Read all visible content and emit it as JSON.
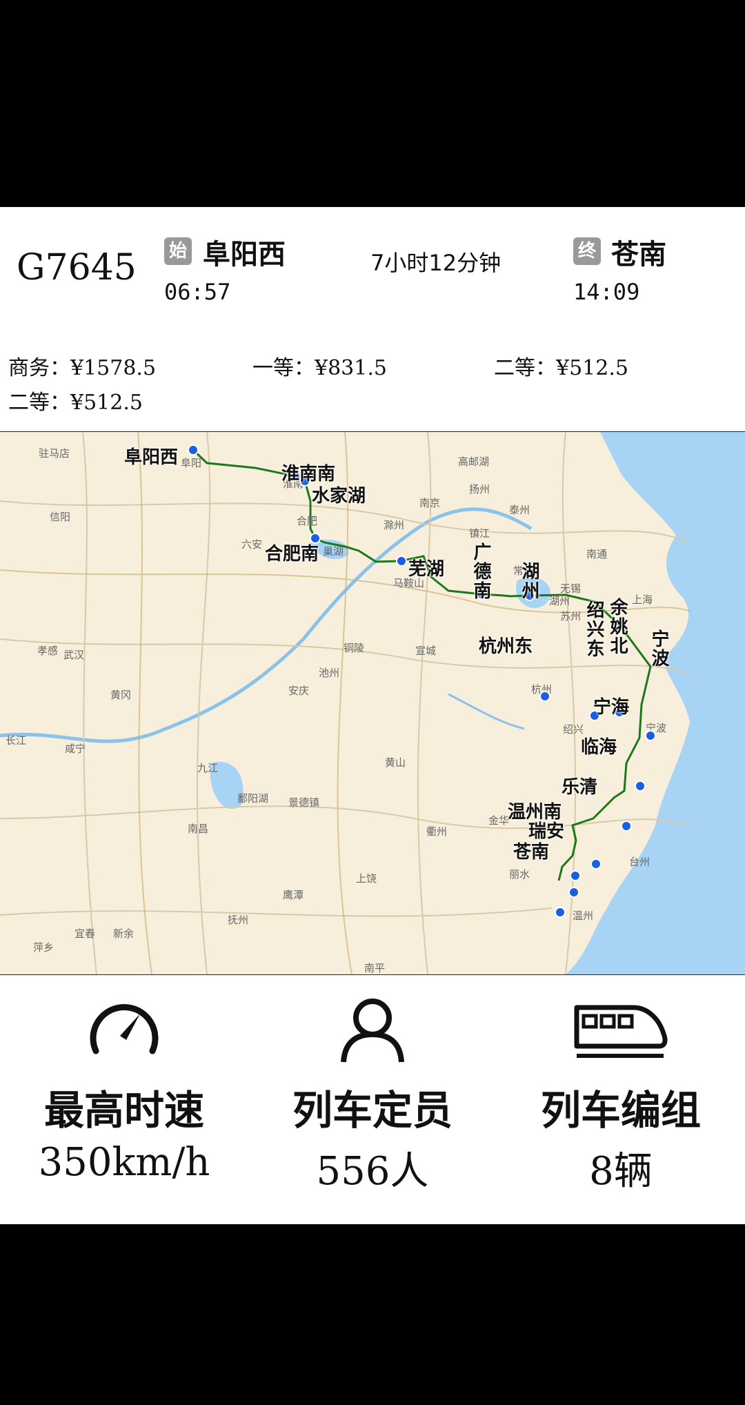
{
  "train": {
    "number": "G7645",
    "origin": {
      "badge": "始",
      "name": "阜阳西",
      "time": "06:57"
    },
    "destination": {
      "badge": "终",
      "name": "苍南",
      "time": "14:09"
    },
    "duration": "7小时12分钟"
  },
  "prices": [
    {
      "text": "商务：¥1578.5"
    },
    {
      "text": "一等：¥831.5"
    },
    {
      "text": "二等：¥512.5"
    },
    {
      "text": "二等：¥512.5"
    }
  ],
  "map": {
    "route_color": "#1a7a1a",
    "stop_color": "#1a5fe0",
    "stations": [
      "阜阳西",
      "淮南南",
      "水家湖",
      "合肥南",
      "芜湖",
      "广德南",
      "湖州",
      "杭州东",
      "绍兴东",
      "余姚北",
      "宁波",
      "宁海",
      "临海",
      "乐清",
      "温州南",
      "瑞安",
      "苍南"
    ],
    "cities": [
      "驻马店",
      "信阳",
      "阜阳",
      "淮南",
      "合肥",
      "六安",
      "巢湖",
      "南京",
      "滁州",
      "扬州",
      "镇江",
      "泰州",
      "高邮湖",
      "常州",
      "无锡",
      "苏州",
      "南通",
      "上海",
      "马鞍山",
      "宣城",
      "铜陵",
      "池州",
      "安庆",
      "武汉",
      "孝感",
      "黄冈",
      "咸宁",
      "九江",
      "长江",
      "鄱阳湖",
      "景德镇",
      "南昌",
      "黄山",
      "杭州",
      "湖州",
      "绍兴",
      "宁波",
      "台州",
      "金华",
      "衢州",
      "丽水",
      "上饶",
      "鹰潭",
      "抚州",
      "宜春",
      "新余",
      "萍乡",
      "温州",
      "南平"
    ]
  },
  "stats": [
    {
      "icon": "speedometer-icon",
      "label": "最高时速",
      "value": "350km/h"
    },
    {
      "icon": "person-icon",
      "label": "列车定员",
      "value": "556人"
    },
    {
      "icon": "train-icon",
      "label": "列车编组",
      "value": "8辆"
    }
  ]
}
